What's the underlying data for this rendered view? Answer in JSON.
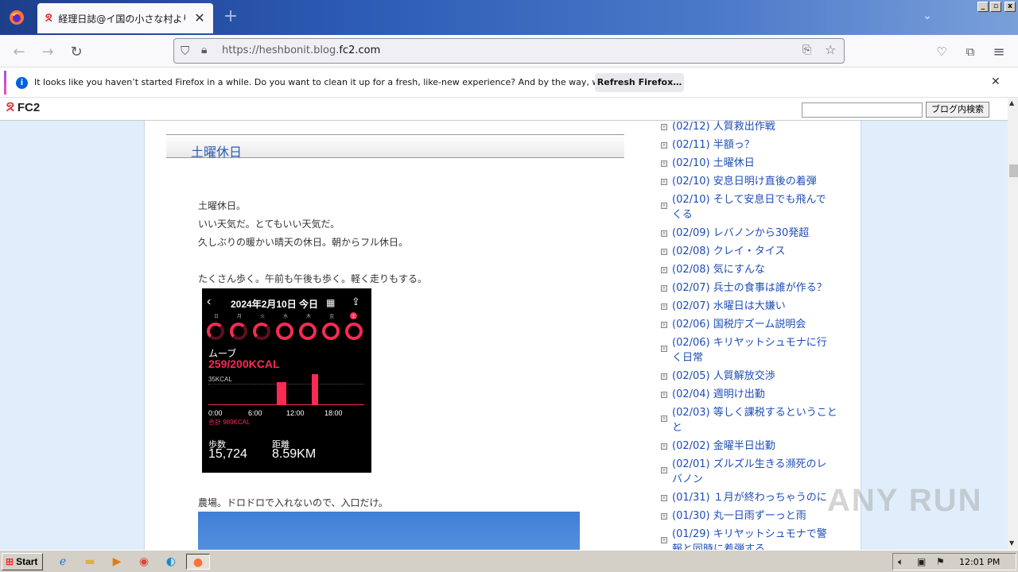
{
  "browser": {
    "tab_title": "経理日誌@イ国の小さな村より",
    "tab_close": "✕",
    "new_tab": "+",
    "url_prefix": "https://heshbonit.blog.",
    "url_domain": "fc2.com"
  },
  "notification": {
    "message": "It looks like you haven’t started Firefox in a while. Do you want to clean it up for a fresh, like-new experience? And by the way, welcome back!",
    "refresh_label": "Refresh Firefox…",
    "close": "✕"
  },
  "fc2": {
    "logo_text": "FC2",
    "search_button": "ブログ内検索",
    "search_value": ""
  },
  "entry": {
    "title": "土曜休日",
    "lines": [
      "土曜休日。",
      "いい天気だ。とてもいい天気だ。",
      "久しぶりの暖かい晴天の休日。朝からフル休日。",
      "たくさん歩く。午前も午後も歩く。軽く走りもする。",
      "農場。ドロドロで入れないので、入口だけ。"
    ]
  },
  "watch": {
    "date_title": "2024年2月10日 今日",
    "days": [
      "日",
      "月",
      "火",
      "水",
      "木",
      "金",
      "土"
    ],
    "move_label": "ムーブ",
    "move_value": "259/200KCAL",
    "chart_max": "35KCAL",
    "times": [
      "0:00",
      "6:00",
      "12:00",
      "18:00"
    ],
    "total": "合計 989KCAL",
    "steps_label": "歩数",
    "steps_value": "15,724",
    "distance_label": "距離",
    "distance_value": "8.59KM"
  },
  "sidebar": {
    "items": [
      {
        "text": "(02/12) 人質救出作戦"
      },
      {
        "text": "(02/11) 半額っ？"
      },
      {
        "text": "(02/10) 土曜休日"
      },
      {
        "text": "(02/10) 安息日明け直後の着弾"
      },
      {
        "text": "(02/10) そして安息日でも飛んで",
        "text2": "くる"
      },
      {
        "text": "(02/09) レバノンから30発超"
      },
      {
        "text": "(02/08) クレイ・タイス"
      },
      {
        "text": "(02/08) 気にすんな"
      },
      {
        "text": "(02/07) 兵士の食事は誰が作る？"
      },
      {
        "text": "(02/07) 水曜日は大嫌い"
      },
      {
        "text": "(02/06) 国税庁ズーム説明会"
      },
      {
        "text": "(02/06) キリヤットシュモナに行",
        "text2": "く日常"
      },
      {
        "text": "(02/05) 人質解放交渉"
      },
      {
        "text": "(02/04) 週明け出勤"
      },
      {
        "text": "(02/03) 等しく課税するということ",
        "text2": "と"
      },
      {
        "text": "(02/02) 金曜半日出勤"
      },
      {
        "text": "(02/01) ズルズル生きる瀕死のレ",
        "text2": "バノン"
      },
      {
        "text": "(01/31) １月が終わっちゃうのに"
      },
      {
        "text": "(01/30) 丸一日雨ずーっと雨"
      },
      {
        "text": "(01/29) キリヤットシュモナで警",
        "text2": "報と同時に着弾する"
      }
    ]
  },
  "taskbar": {
    "start_label": "Start",
    "clock": "12:01 PM"
  },
  "watermark": "ANY RUN"
}
